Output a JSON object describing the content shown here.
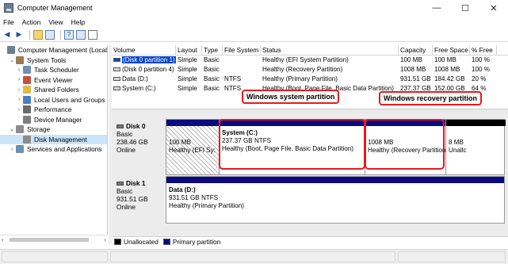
{
  "window": {
    "title": "Computer Management",
    "btn_min": "—",
    "btn_max": "☐",
    "btn_close": "✕"
  },
  "menu": [
    "File",
    "Action",
    "View",
    "Help"
  ],
  "toolbar_icons": [
    "back-arrow-icon",
    "forward-arrow-icon",
    "folder-up-icon",
    "show-tree-icon",
    "help-icon",
    "properties-icon",
    "console-icon"
  ],
  "tree": [
    {
      "label": "Computer Management (Local",
      "depth": 0,
      "twisty": "",
      "icon": "computer-icon",
      "color": "#6a7f94"
    },
    {
      "label": "System Tools",
      "depth": 1,
      "twisty": "⌄",
      "icon": "tools-icon",
      "color": "#9a7a52"
    },
    {
      "label": "Task Scheduler",
      "depth": 2,
      "twisty": "›",
      "icon": "clock-icon",
      "color": "#6f8fb0"
    },
    {
      "label": "Event Viewer",
      "depth": 2,
      "twisty": "›",
      "icon": "event-viewer-icon",
      "color": "#c94e3d"
    },
    {
      "label": "Shared Folders",
      "depth": 2,
      "twisty": "›",
      "icon": "shared-folder-icon",
      "color": "#e0b84b"
    },
    {
      "label": "Local Users and Groups",
      "depth": 2,
      "twisty": "›",
      "icon": "users-icon",
      "color": "#4c7cc2"
    },
    {
      "label": "Performance",
      "depth": 2,
      "twisty": "›",
      "icon": "performance-icon",
      "color": "#6a6a6a"
    },
    {
      "label": "Device Manager",
      "depth": 2,
      "twisty": "",
      "icon": "device-manager-icon",
      "color": "#7f7f7f"
    },
    {
      "label": "Storage",
      "depth": 1,
      "twisty": "⌄",
      "icon": "storage-icon",
      "color": "#8b8b8b"
    },
    {
      "label": "Disk Management",
      "depth": 2,
      "twisty": "",
      "icon": "disk-management-icon",
      "color": "#8b8b8b",
      "selected": true
    },
    {
      "label": "Services and Applications",
      "depth": 1,
      "twisty": "›",
      "icon": "services-icon",
      "color": "#6f8fb0"
    }
  ],
  "volumes": {
    "headers": [
      "Volume",
      "Layout",
      "Type",
      "File System",
      "Status",
      "Capacity",
      "Free Space",
      "% Free"
    ],
    "rows": [
      [
        "(Disk 0 partition 1)",
        "Simple",
        "Basic",
        "",
        "Healthy (EFI System Partition)",
        "100 MB",
        "100 MB",
        "100 %"
      ],
      [
        "(Disk 0 partition 4)",
        "Simple",
        "Basic",
        "",
        "Healthy (Recovery Partition)",
        "1008 MB",
        "1008 MB",
        "100 %"
      ],
      [
        "Data (D:)",
        "Simple",
        "Basic",
        "NTFS",
        "Healthy (Primary Partition)",
        "931.51 GB",
        "184.42 GB",
        "20 %"
      ],
      [
        "System (C:)",
        "Simple",
        "Basic",
        "NTFS",
        "Healthy (Boot, Page File, Basic Data Partition)",
        "237.37 GB",
        "152.00 GB",
        "64 %"
      ]
    ]
  },
  "disks": [
    {
      "name": "Disk 0",
      "type": "Basic",
      "size": "238.46 GB",
      "state": "Online",
      "parts": [
        {
          "title": "",
          "l1": "100 MB",
          "l2": "Healthy (EFI Sy:"
        },
        {
          "title": "System  (C:)",
          "l1": "237.37 GB NTFS",
          "l2": "Healthy (Boot, Page File, Basic Data Partition)"
        },
        {
          "title": "",
          "l1": "1008 MB",
          "l2": "Healthy (Recovery Partition"
        },
        {
          "title": "",
          "l1": "8 MB",
          "l2": "Unallc"
        }
      ]
    },
    {
      "name": "Disk 1",
      "type": "Basic",
      "size": "931.51 GB",
      "state": "Online",
      "parts": [
        {
          "title": "Data  (D:)",
          "l1": "931.51 GB NTFS",
          "l2": "Healthy (Primary Partition)"
        }
      ]
    }
  ],
  "callouts": {
    "system": "Windows system partition",
    "recovery": "Windows recovery partition"
  },
  "legend": {
    "unallocated": "Unallocated",
    "primary": "Primary partition"
  },
  "colors": {
    "primary": "#0a0a80",
    "unallocated": "#000000",
    "highlight": "#e8191e",
    "selection": "#cce4f7"
  }
}
